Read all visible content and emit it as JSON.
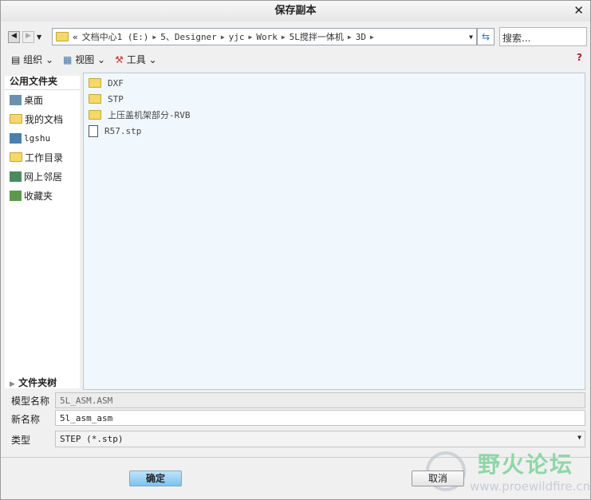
{
  "title": "保存副本",
  "address": {
    "crumbs": [
      "文档中心1 (E:)",
      "5、Designer",
      "yjc",
      "Work",
      "5L搅拌一体机",
      "3D"
    ]
  },
  "search_placeholder": "搜索...",
  "toolbar": {
    "organize": "组织",
    "view": "视图",
    "tools": "工具"
  },
  "nav": {
    "header": "公用文件夹",
    "items": [
      "桌面",
      "我的文档",
      "lgshu",
      "工作目录",
      "网上邻居",
      "收藏夹"
    ],
    "tree": "文件夹树"
  },
  "files": [
    {
      "name": "DXF",
      "type": "folder"
    },
    {
      "name": "STP",
      "type": "folder"
    },
    {
      "name": "上压盖机架部分-RVB",
      "type": "folder"
    },
    {
      "name": "R57.stp",
      "type": "file"
    }
  ],
  "form": {
    "model_label": "模型名称",
    "model_value": "5L_ASM.ASM",
    "newname_label": "新名称",
    "newname_value": "5l_asm_asm",
    "type_label": "类型",
    "type_value": "STEP (*.stp)"
  },
  "buttons": {
    "ok": "确定",
    "cancel": "取消"
  },
  "watermark": {
    "name": "野火论坛",
    "url": "www.proewildfire.cn"
  }
}
